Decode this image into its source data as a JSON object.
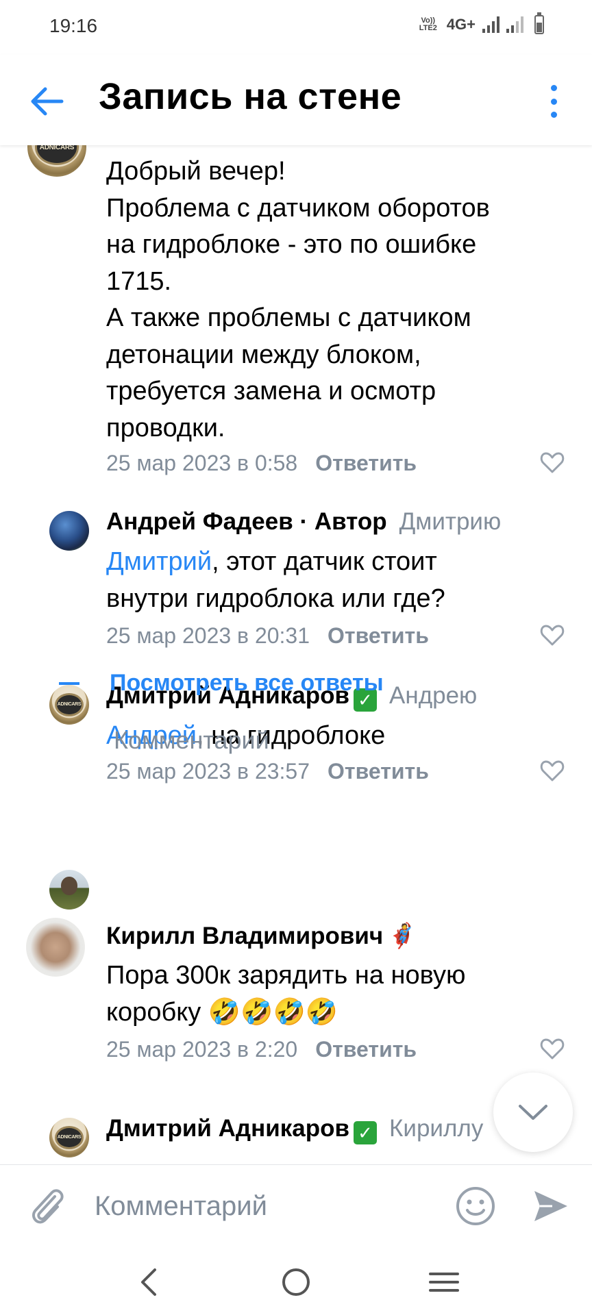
{
  "status": {
    "time": "19:16",
    "volte": "Vo)) LTE2",
    "network": "4G+"
  },
  "header": {
    "title": "Запись на стене"
  },
  "comments": [
    {
      "lines": [
        "Добрый вечер!",
        "Проблема с датчиком оборотов",
        "на гидроблоке - это по ошибке",
        "1715.",
        "А также проблемы с датчиком",
        "детонации между блоком,",
        "требуется замена и осмотр",
        "проводки."
      ],
      "date": "25 мар 2023 в 0:58",
      "reply": "Ответить",
      "avatar_label": "ADNICARS"
    },
    {
      "author": "Андрей Фадеев · Автор",
      "reply_to": "Дмитрию",
      "mention": "Дмитрий",
      "lines": [
        ", этот датчик стоит",
        "внутри гидроблока или где?"
      ],
      "date": "25 мар 2023 в 20:31",
      "reply": "Ответить"
    },
    {
      "author": "Дмитрий Адникаров",
      "verified": "✓",
      "reply_to": "Андрею",
      "mention": "Андрей",
      "lines": [
        ", на гидроблоке"
      ],
      "date": "25 мар 2023 в 23:57",
      "reply": "Ответить",
      "avatar_label": "ADNICARS"
    },
    {
      "author": "Кирилл Владимирович",
      "author_emoji": "🦸",
      "lines": [
        "Пора 300к зарядить на новую",
        "коробку 🤣🤣🤣🤣"
      ],
      "date": "25 мар 2023 в 2:20",
      "reply": "Ответить"
    },
    {
      "author": "Дмитрий Адникаров",
      "verified": "✓",
      "reply_to": "Кириллу",
      "avatar_label": "ADNICARS"
    }
  ],
  "show_all_replies": "Посмотреть все ответы",
  "comment_prompt": "Комментарий",
  "composer": {
    "placeholder": "Комментарий"
  },
  "icons": {
    "back": "arrow-left-icon",
    "more": "vertical-dots-icon",
    "like": "heart-outline-icon",
    "scroll": "chevron-down-icon",
    "attach": "paperclip-icon",
    "emoji": "smiley-icon",
    "send": "send-icon",
    "nav": [
      "chevron-left-icon",
      "circle-home-icon",
      "recent-apps-icon"
    ]
  },
  "colors": {
    "accent": "#2787f5",
    "secondary_text": "#818c99",
    "verified": "#2aa43b"
  }
}
